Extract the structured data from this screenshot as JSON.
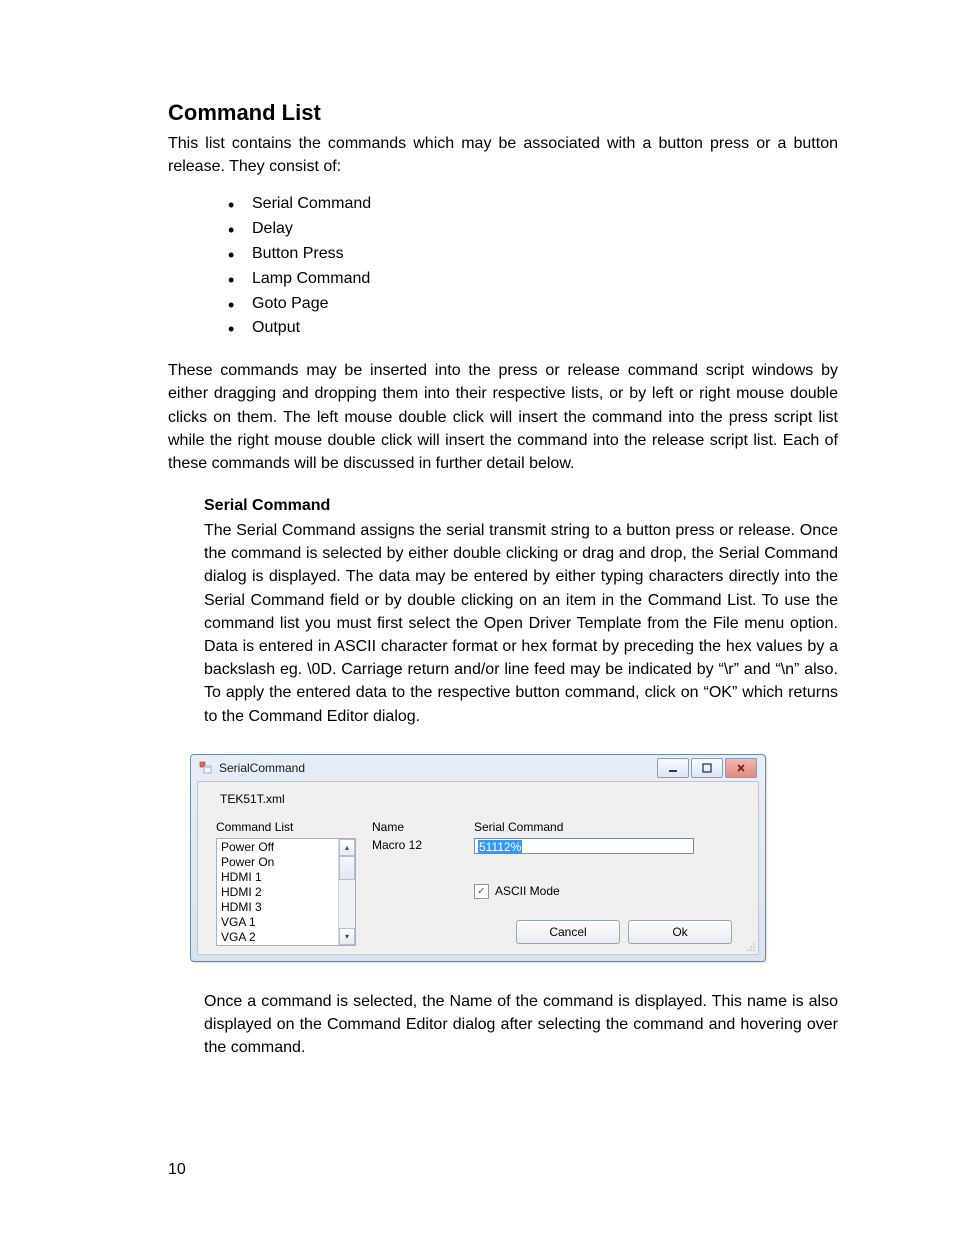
{
  "heading": "Command List",
  "intro": "This list contains the commands which may be associated with a button press or a button release. They consist of:",
  "bullets": [
    "Serial Command",
    "Delay",
    "Button Press",
    "Lamp Command",
    "Goto Page",
    "Output"
  ],
  "para2": "These commands may be inserted into the press or release command script windows by either dragging and dropping them into their respective lists, or by left or right mouse double clicks on them. The left mouse double click will insert the command into the press script list while the right mouse double click will insert the command into the release script list. Each of these commands will be discussed in further detail below.",
  "sub_heading": "Serial Command",
  "sub_para": "The Serial Command assigns the serial transmit string to a button press or release. Once the command is selected by either double clicking or drag and drop, the Serial Command dialog is displayed. The data may be entered by either typing characters directly into the Serial Command field or by double clicking on an item in the Command List. To use the command list you must first select the Open Driver Template from the File menu option. Data is entered in ASCII character format or hex format by preceding the hex values by a backslash eg. \\0D. Carriage return and/or line feed may be indicated by “\\r” and “\\n” also. To apply the entered data to the respective button command, click on “OK” which returns to the Command Editor dialog.",
  "dialog": {
    "title": "SerialCommand",
    "filename": "TEK51T.xml",
    "labels": {
      "command_list": "Command List",
      "name": "Name",
      "serial_command": "Serial Command",
      "ascii_mode": "ASCII Mode"
    },
    "list_items": [
      "Power Off",
      "Power On",
      "HDMI 1",
      "HDMI 2",
      "HDMI 3",
      "VGA 1",
      "VGA 2"
    ],
    "name_value": "Macro 12",
    "serial_value": "51112%",
    "ascii_checked": true,
    "cancel_label": "Cancel",
    "ok_label": "Ok"
  },
  "after_para": "Once a command is selected, the Name of the command is displayed. This name is also displayed on the Command Editor dialog after selecting the command and hovering over the command.",
  "page_number": "10"
}
